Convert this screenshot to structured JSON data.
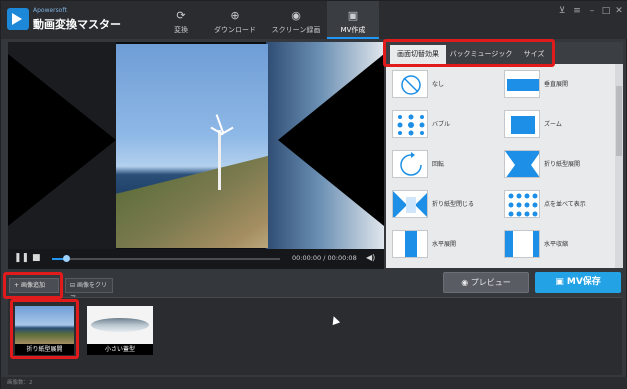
{
  "app": {
    "brand": "Apowersoft",
    "title": "動画変換マスター"
  },
  "nav": {
    "tabs": [
      {
        "label": "変換",
        "icon": "refresh-icon"
      },
      {
        "label": "ダウンロード",
        "icon": "download-icon"
      },
      {
        "label": "スクリーン録画",
        "icon": "record-icon"
      },
      {
        "label": "MV作成",
        "icon": "tv-icon"
      }
    ],
    "active": "MV作成"
  },
  "window_controls": [
    "cart-icon",
    "menu-icon",
    "minimize-icon",
    "maximize-icon",
    "close-icon"
  ],
  "player": {
    "time": "00:00:00 / 00:00:08",
    "progress": 0.06
  },
  "effects_panel": {
    "tabs": [
      "画面切替効果",
      "バックミュージック",
      "サイズ"
    ],
    "active_tab": "画面切替効果",
    "items": [
      {
        "label": "なし"
      },
      {
        "label": "垂直展開"
      },
      {
        "label": "バブル"
      },
      {
        "label": "ズーム"
      },
      {
        "label": "回転"
      },
      {
        "label": "折り紙型展開"
      },
      {
        "label": "折り紙型閉じる"
      },
      {
        "label": "点を並べて表示"
      },
      {
        "label": "水平展開"
      },
      {
        "label": "水平収縮"
      }
    ]
  },
  "actions": {
    "preview": "プレビュー",
    "save": "MV保存",
    "add_image": "画像追加",
    "clear_image": "画像をクリア"
  },
  "clips": [
    {
      "caption": "折り紙型展開"
    },
    {
      "caption": "小さい蓋型"
    }
  ],
  "status": "画像数：2",
  "colors": {
    "accent": "#2196f3",
    "save": "#23a3e6",
    "highlight": "#e11b1b",
    "icon_blue": "#1e8fe6"
  }
}
